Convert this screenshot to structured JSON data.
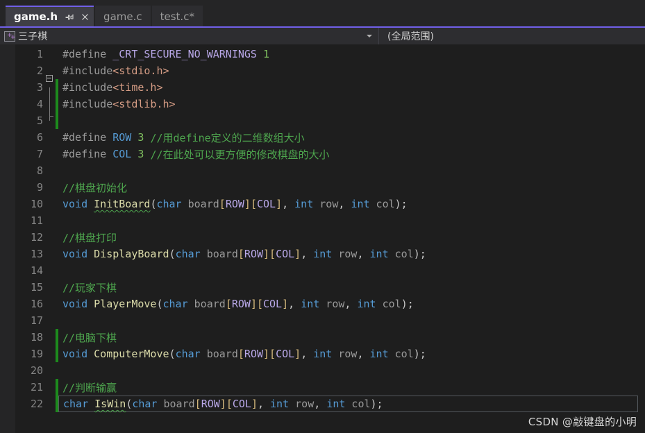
{
  "tabs": [
    {
      "label": "game.h",
      "active": true,
      "modified": false,
      "pin_icon": "pin-icon",
      "close_icon": "close-icon"
    },
    {
      "label": "game.c",
      "active": false,
      "modified": false
    },
    {
      "label": "test.c*",
      "active": false,
      "modified": true
    }
  ],
  "navbar": {
    "project_icon": "cpp-project-icon",
    "project": "三子棋",
    "dropdown_icon": "chevron-down-icon",
    "scope": "(全局范围)"
  },
  "editor": {
    "lines": [
      {
        "number": "1",
        "changed": false,
        "current": false,
        "tokens": [
          {
            "t": "#define ",
            "c": "tok-pre"
          },
          {
            "t": "_CRT_SECURE_NO_WARNINGS ",
            "c": "tok-macro"
          },
          {
            "t": "1",
            "c": "tok-num"
          }
        ]
      },
      {
        "number": "2",
        "changed": false,
        "current": false,
        "fold": "start",
        "tokens": [
          {
            "t": "#include",
            "c": "tok-pre"
          },
          {
            "t": "<stdio.h>",
            "c": "tok-inc"
          }
        ]
      },
      {
        "number": "3",
        "changed": true,
        "current": false,
        "fold": "mid",
        "tokens": [
          {
            "t": "#include",
            "c": "tok-pre"
          },
          {
            "t": "<time.h>",
            "c": "tok-inc"
          }
        ]
      },
      {
        "number": "4",
        "changed": true,
        "current": false,
        "fold": "end",
        "tokens": [
          {
            "t": "#include",
            "c": "tok-pre"
          },
          {
            "t": "<stdlib.h>",
            "c": "tok-inc"
          }
        ]
      },
      {
        "number": "5",
        "changed": true,
        "current": false,
        "tokens": []
      },
      {
        "number": "6",
        "changed": false,
        "current": false,
        "tokens": [
          {
            "t": "#define ",
            "c": "tok-pre"
          },
          {
            "t": "ROW",
            "c": "tok-kw"
          },
          {
            "t": " ",
            "c": "tok-id"
          },
          {
            "t": "3",
            "c": "tok-num"
          },
          {
            "t": " ",
            "c": "tok-id"
          },
          {
            "t": "//用define定义的二维数组大小",
            "c": "tok-comment"
          }
        ]
      },
      {
        "number": "7",
        "changed": false,
        "current": false,
        "tokens": [
          {
            "t": "#define ",
            "c": "tok-pre"
          },
          {
            "t": "COL",
            "c": "tok-kw"
          },
          {
            "t": " ",
            "c": "tok-id"
          },
          {
            "t": "3",
            "c": "tok-num"
          },
          {
            "t": " ",
            "c": "tok-id"
          },
          {
            "t": "//在此处可以更方便的修改棋盘的大小",
            "c": "tok-comment"
          }
        ]
      },
      {
        "number": "8",
        "changed": false,
        "current": false,
        "tokens": []
      },
      {
        "number": "9",
        "changed": false,
        "current": false,
        "tokens": [
          {
            "t": "//棋盘初始化",
            "c": "tok-comment"
          }
        ]
      },
      {
        "number": "10",
        "changed": false,
        "current": false,
        "tokens": [
          {
            "t": "void",
            "c": "tok-kw"
          },
          {
            "t": " ",
            "c": "tok-id"
          },
          {
            "t": "InitBoard",
            "c": "tok-fn",
            "squiggle": true
          },
          {
            "t": "(",
            "c": "tok-punct"
          },
          {
            "t": "char",
            "c": "tok-kw"
          },
          {
            "t": " board",
            "c": "tok-id"
          },
          {
            "t": "[",
            "c": "tok-brk"
          },
          {
            "t": "ROW",
            "c": "tok-const"
          },
          {
            "t": "]",
            "c": "tok-brk"
          },
          {
            "t": "[",
            "c": "tok-brk"
          },
          {
            "t": "COL",
            "c": "tok-const"
          },
          {
            "t": "]",
            "c": "tok-brk"
          },
          {
            "t": ", ",
            "c": "tok-punct"
          },
          {
            "t": "int",
            "c": "tok-kw"
          },
          {
            "t": " row",
            "c": "tok-id"
          },
          {
            "t": ", ",
            "c": "tok-punct"
          },
          {
            "t": "int",
            "c": "tok-kw"
          },
          {
            "t": " col",
            "c": "tok-id"
          },
          {
            "t": ");",
            "c": "tok-punct"
          }
        ]
      },
      {
        "number": "11",
        "changed": false,
        "current": false,
        "tokens": []
      },
      {
        "number": "12",
        "changed": false,
        "current": false,
        "tokens": [
          {
            "t": "//棋盘打印",
            "c": "tok-comment"
          }
        ]
      },
      {
        "number": "13",
        "changed": false,
        "current": false,
        "tokens": [
          {
            "t": "void",
            "c": "tok-kw"
          },
          {
            "t": " ",
            "c": "tok-id"
          },
          {
            "t": "DisplayBoard",
            "c": "tok-fn"
          },
          {
            "t": "(",
            "c": "tok-punct"
          },
          {
            "t": "char",
            "c": "tok-kw"
          },
          {
            "t": " board",
            "c": "tok-id"
          },
          {
            "t": "[",
            "c": "tok-brk"
          },
          {
            "t": "ROW",
            "c": "tok-const"
          },
          {
            "t": "]",
            "c": "tok-brk"
          },
          {
            "t": "[",
            "c": "tok-brk"
          },
          {
            "t": "COL",
            "c": "tok-const"
          },
          {
            "t": "]",
            "c": "tok-brk"
          },
          {
            "t": ", ",
            "c": "tok-punct"
          },
          {
            "t": "int",
            "c": "tok-kw"
          },
          {
            "t": " row",
            "c": "tok-id"
          },
          {
            "t": ", ",
            "c": "tok-punct"
          },
          {
            "t": "int",
            "c": "tok-kw"
          },
          {
            "t": " col",
            "c": "tok-id"
          },
          {
            "t": ");",
            "c": "tok-punct"
          }
        ]
      },
      {
        "number": "14",
        "changed": false,
        "current": false,
        "tokens": []
      },
      {
        "number": "15",
        "changed": false,
        "current": false,
        "tokens": [
          {
            "t": "//玩家下棋",
            "c": "tok-comment"
          }
        ]
      },
      {
        "number": "16",
        "changed": false,
        "current": false,
        "tokens": [
          {
            "t": "void",
            "c": "tok-kw"
          },
          {
            "t": " ",
            "c": "tok-id"
          },
          {
            "t": "PlayerMove",
            "c": "tok-fn"
          },
          {
            "t": "(",
            "c": "tok-punct"
          },
          {
            "t": "char",
            "c": "tok-kw"
          },
          {
            "t": " board",
            "c": "tok-id"
          },
          {
            "t": "[",
            "c": "tok-brk"
          },
          {
            "t": "ROW",
            "c": "tok-const"
          },
          {
            "t": "]",
            "c": "tok-brk"
          },
          {
            "t": "[",
            "c": "tok-brk"
          },
          {
            "t": "COL",
            "c": "tok-const"
          },
          {
            "t": "]",
            "c": "tok-brk"
          },
          {
            "t": ", ",
            "c": "tok-punct"
          },
          {
            "t": "int",
            "c": "tok-kw"
          },
          {
            "t": " row",
            "c": "tok-id"
          },
          {
            "t": ", ",
            "c": "tok-punct"
          },
          {
            "t": "int",
            "c": "tok-kw"
          },
          {
            "t": " col",
            "c": "tok-id"
          },
          {
            "t": ");",
            "c": "tok-punct"
          }
        ]
      },
      {
        "number": "17",
        "changed": false,
        "current": false,
        "tokens": []
      },
      {
        "number": "18",
        "changed": true,
        "current": false,
        "tokens": [
          {
            "t": "//电脑下棋",
            "c": "tok-comment"
          }
        ]
      },
      {
        "number": "19",
        "changed": true,
        "current": false,
        "tokens": [
          {
            "t": "void",
            "c": "tok-kw"
          },
          {
            "t": " ",
            "c": "tok-id"
          },
          {
            "t": "ComputerMove",
            "c": "tok-fn"
          },
          {
            "t": "(",
            "c": "tok-punct"
          },
          {
            "t": "char",
            "c": "tok-kw"
          },
          {
            "t": " board",
            "c": "tok-id"
          },
          {
            "t": "[",
            "c": "tok-brk"
          },
          {
            "t": "ROW",
            "c": "tok-const"
          },
          {
            "t": "]",
            "c": "tok-brk"
          },
          {
            "t": "[",
            "c": "tok-brk"
          },
          {
            "t": "COL",
            "c": "tok-const"
          },
          {
            "t": "]",
            "c": "tok-brk"
          },
          {
            "t": ", ",
            "c": "tok-punct"
          },
          {
            "t": "int",
            "c": "tok-kw"
          },
          {
            "t": " row",
            "c": "tok-id"
          },
          {
            "t": ", ",
            "c": "tok-punct"
          },
          {
            "t": "int",
            "c": "tok-kw"
          },
          {
            "t": " col",
            "c": "tok-id"
          },
          {
            "t": ");",
            "c": "tok-punct"
          }
        ]
      },
      {
        "number": "20",
        "changed": false,
        "current": false,
        "tokens": []
      },
      {
        "number": "21",
        "changed": true,
        "current": false,
        "tokens": [
          {
            "t": "//判断输赢",
            "c": "tok-comment"
          }
        ]
      },
      {
        "number": "22",
        "changed": true,
        "current": true,
        "quick_action_icon": "screwdriver-icon",
        "tokens": [
          {
            "t": "char",
            "c": "tok-kw"
          },
          {
            "t": " ",
            "c": "tok-id"
          },
          {
            "t": "IsWin",
            "c": "tok-fn",
            "squiggle": true
          },
          {
            "t": "(",
            "c": "tok-punct"
          },
          {
            "t": "char",
            "c": "tok-kw"
          },
          {
            "t": " board",
            "c": "tok-id"
          },
          {
            "t": "[",
            "c": "tok-brk"
          },
          {
            "t": "ROW",
            "c": "tok-const"
          },
          {
            "t": "]",
            "c": "tok-brk"
          },
          {
            "t": "[",
            "c": "tok-brk"
          },
          {
            "t": "COL",
            "c": "tok-const"
          },
          {
            "t": "]",
            "c": "tok-brk"
          },
          {
            "t": ", ",
            "c": "tok-punct"
          },
          {
            "t": "int",
            "c": "tok-kw"
          },
          {
            "t": " row",
            "c": "tok-id"
          },
          {
            "t": ", ",
            "c": "tok-punct"
          },
          {
            "t": "int",
            "c": "tok-kw"
          },
          {
            "t": " col",
            "c": "tok-id"
          },
          {
            "t": ");",
            "c": "tok-punct"
          }
        ]
      }
    ]
  },
  "watermark": {
    "text": "CSDN @敲键盘的小明"
  },
  "colors": {
    "editor_background": "#1e1e1e",
    "tab_active_background": "#3f3f46",
    "tab_accent": "#7160e8",
    "gutter_background": "#252526",
    "navbar_background": "#2d2d30",
    "change_bar": "#1d8a1d",
    "comment": "#4ea64e",
    "keyword": "#569cd6",
    "function": "#dcdcaa",
    "macro": "#b9a8e8",
    "include_path": "#d69d85",
    "bracket": "#d7ba7d",
    "line_number": "#858585"
  }
}
